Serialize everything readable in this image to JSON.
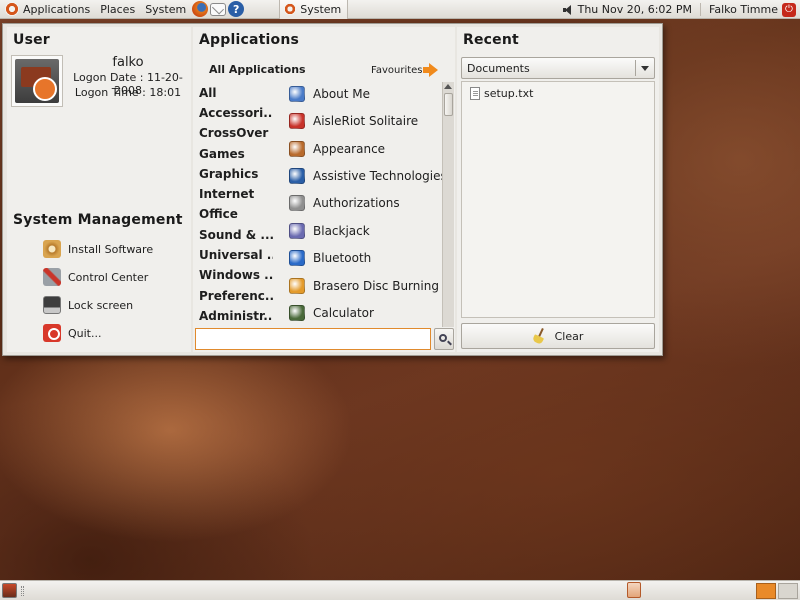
{
  "top_panel": {
    "menus": [
      "Applications",
      "Places",
      "System"
    ],
    "launchers": [
      "firefox-icon",
      "mail-icon",
      "help-icon"
    ],
    "task_button": "System",
    "clock": "Thu Nov 20,  6:02 PM",
    "username": "Falko Timme"
  },
  "user": {
    "heading": "User",
    "name": "falko",
    "logon_date": "Logon Date : 11-20-2008",
    "logon_time": "Logon Time : 18:01"
  },
  "system_management": {
    "heading": "System Management",
    "items": [
      {
        "label": "Install Software",
        "icon": "install-software-icon"
      },
      {
        "label": "Control Center",
        "icon": "control-center-icon"
      },
      {
        "label": "Lock screen",
        "icon": "lock-screen-icon"
      },
      {
        "label": "Quit...",
        "icon": "quit-icon"
      }
    ]
  },
  "applications": {
    "heading": "Applications",
    "all_label": "All Applications",
    "favourites_label": "Favourites",
    "categories": [
      "All",
      "Accessori...",
      "CrossOver",
      "Games",
      "Graphics",
      "Internet",
      "Office",
      "Sound & ...",
      "Universal ...",
      "Windows ...",
      "Preferenc...",
      "Administr..."
    ],
    "apps": [
      {
        "label": "About Me",
        "color": "#4a7bc8"
      },
      {
        "label": "AisleRiot Solitaire",
        "color": "#c8322a"
      },
      {
        "label": "Appearance",
        "color": "#b86a2c"
      },
      {
        "label": "Assistive Technologies",
        "color": "#2a5ea6"
      },
      {
        "label": "Authorizations",
        "color": "#8f8f8f"
      },
      {
        "label": "Blackjack",
        "color": "#6a6ab0"
      },
      {
        "label": "Bluetooth",
        "color": "#2a6ac8"
      },
      {
        "label": "Brasero Disc Burning",
        "color": "#e39a2a"
      },
      {
        "label": "Calculator",
        "color": "#4a6a3a"
      }
    ],
    "search_value": ""
  },
  "recent": {
    "heading": "Recent",
    "selected_filter": "Documents",
    "items": [
      "setup.txt"
    ],
    "clear_label": "Clear"
  },
  "colors": {
    "accent": "#e98a29",
    "panel": "#dedbd5",
    "menu_background": "#e8e6e1"
  }
}
